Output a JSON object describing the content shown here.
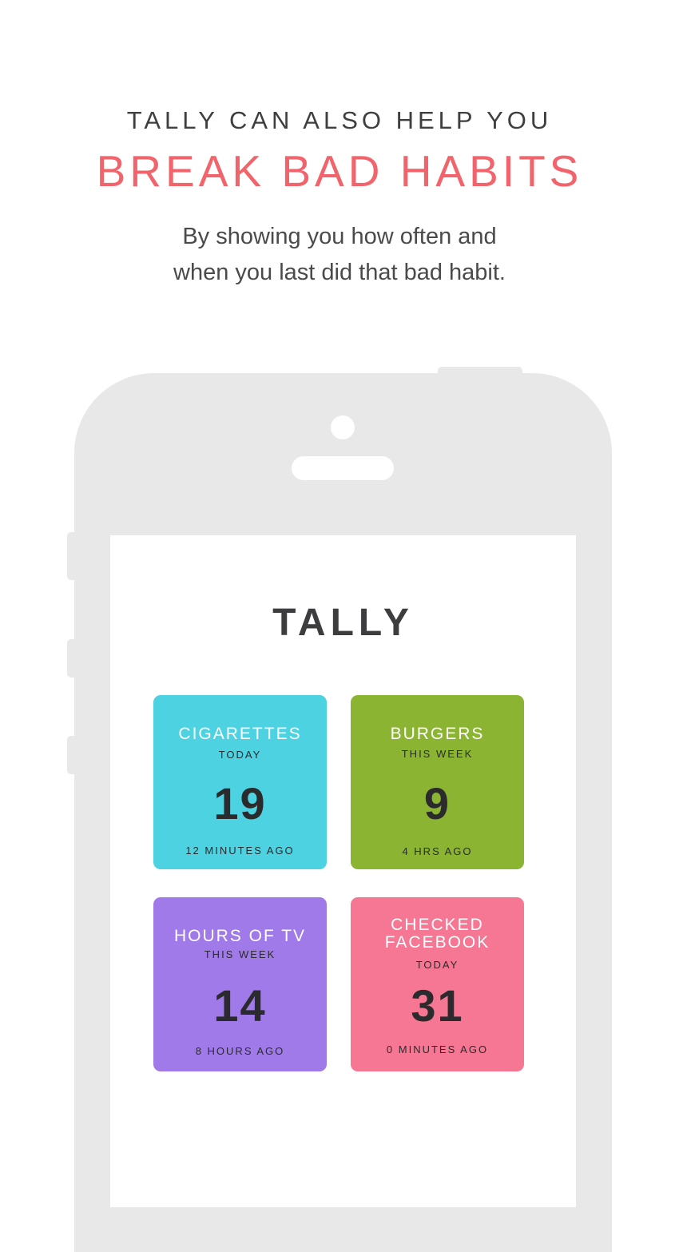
{
  "promo": {
    "headline": "TALLY CAN ALSO HELP YOU",
    "subheadline": "BREAK BAD HABITS",
    "description_line1": "By showing you how often and",
    "description_line2": "when you last did that bad habit."
  },
  "app": {
    "title": "TALLY",
    "tiles": [
      {
        "name": "CIGARETTES",
        "period": "TODAY",
        "count": "19",
        "last": "12 MINUTES AGO",
        "color": "#4dd2e2"
      },
      {
        "name": "BURGERS",
        "period": "THIS WEEK",
        "count": "9",
        "last": "4 HRS AGO",
        "color": "#8bb432"
      },
      {
        "name": "HOURS OF TV",
        "period": "THIS WEEK",
        "count": "14",
        "last": "8 HOURS AGO",
        "color": "#9f7ae8"
      },
      {
        "name_line1": "CHECKED",
        "name_line2": "FACEBOOK",
        "period": "TODAY",
        "count": "31",
        "last": "0 MINUTES AGO",
        "color": "#f57793"
      }
    ]
  },
  "colors": {
    "accent": "#f2646b",
    "phone_body": "#e8e8e8",
    "text_dark": "#3f3f41"
  }
}
